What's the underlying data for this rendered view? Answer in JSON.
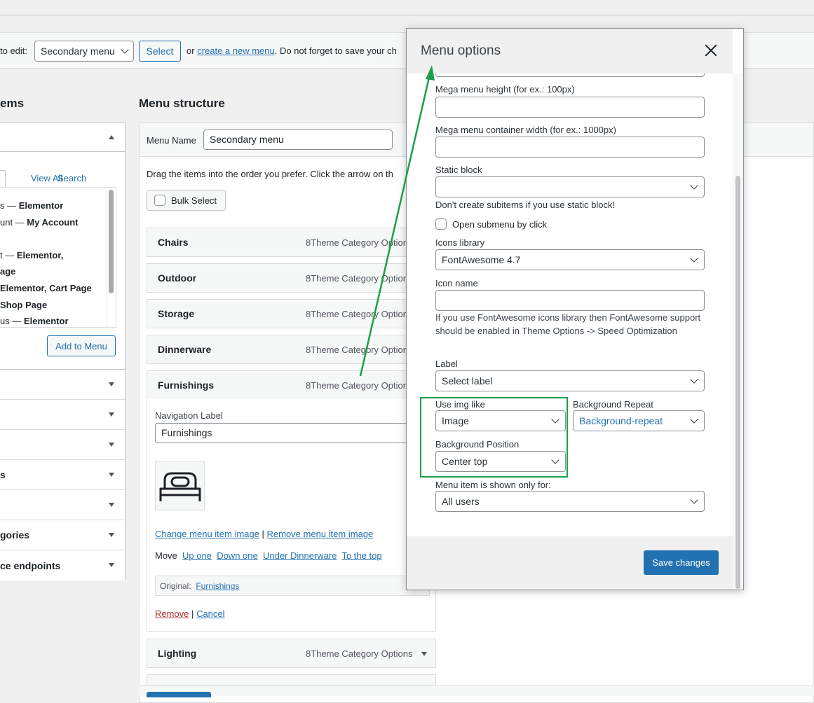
{
  "edit_bar": {
    "prefix": "to edit:",
    "selected_menu": "Secondary menu",
    "select_button": "Select",
    "or_text": "or",
    "create_link": "create a new menu",
    "suffix": ". Do not forget to save your ch"
  },
  "left_column": {
    "heading": "ems",
    "tabs": [
      "View All",
      "Search"
    ],
    "pages": [
      {
        "pre": "s — ",
        "bold": "Elementor"
      },
      {
        "pre": "unt — ",
        "bold": "My Account"
      },
      {
        "pre": "t — ",
        "bold": "Elementor,"
      },
      {
        "pre": "",
        "bold": "age"
      },
      {
        "pre": "",
        "bold": "Elementor, Cart Page"
      },
      {
        "pre": "",
        "bold": "Shop Page"
      },
      {
        "pre": "us — ",
        "bold": "Elementor"
      }
    ],
    "add_button": "Add to Menu",
    "accordion": [
      "",
      "",
      "",
      "s",
      "",
      "gories",
      "ce endpoints"
    ]
  },
  "menu_structure": {
    "heading": "Menu structure",
    "name_label": "Menu Name",
    "name_value": "Secondary menu",
    "instructions": "Drag the items into the order you prefer. Click the arrow on th",
    "bulk_select": "Bulk Select",
    "items": [
      {
        "title": "Chairs",
        "type": "8Theme Category Option"
      },
      {
        "title": "Outdoor",
        "type": "8Theme Category Option"
      },
      {
        "title": "Storage",
        "type": "8Theme Category Option"
      },
      {
        "title": "Dinnerware",
        "type": "8Theme Category Option"
      },
      {
        "title": "Furnishings",
        "type": "8Theme Category Option"
      }
    ],
    "expanded": {
      "nav_label": "Navigation Label",
      "nav_value": "Furnishings",
      "change_image": "Change menu item image",
      "separator": "|",
      "remove_image": "Remove menu item image",
      "move_label": "Move",
      "move_links": [
        "Up one",
        "Down one",
        "Under Dinnerware",
        "To the top"
      ],
      "original_label": "Original:",
      "original_link": "Furnishings",
      "remove": "Remove",
      "cancel": "Cancel"
    },
    "lighting": {
      "title": "Lighting",
      "type": "8Theme Category Options"
    }
  },
  "modal": {
    "title": "Menu options",
    "fields": {
      "mega_height_label": "Mega menu height (for ex.: 100px)",
      "mega_width_label": "Mega menu container width (for ex.: 1000px)",
      "static_block_label": "Static block",
      "static_block_value": "",
      "static_help": "Don't create subitems if you use static block!",
      "open_submenu": "Open submenu by click",
      "icons_library_label": "Icons library",
      "icons_library_value": "FontAwesome 4.7",
      "icon_name_label": "Icon name",
      "icon_help": "If you use FontAwesome icons library then FontAwesome support should be enabled in Theme Options -> Speed Optimization",
      "label_label": "Label",
      "label_value": "Select label",
      "use_img_label": "Use img like",
      "use_img_value": "Image",
      "bg_repeat_label": "Background Repeat",
      "bg_repeat_value": "Background-repeat",
      "bg_position_label": "Background Position",
      "bg_position_value": "Center top",
      "shown_for_label": "Menu item is shown only for:",
      "shown_for_value": "All users"
    },
    "save_button": "Save changes"
  },
  "colors": {
    "accent": "#2271b1",
    "highlight_box": "#1e9e4a",
    "link_danger": "#b32d2e"
  }
}
